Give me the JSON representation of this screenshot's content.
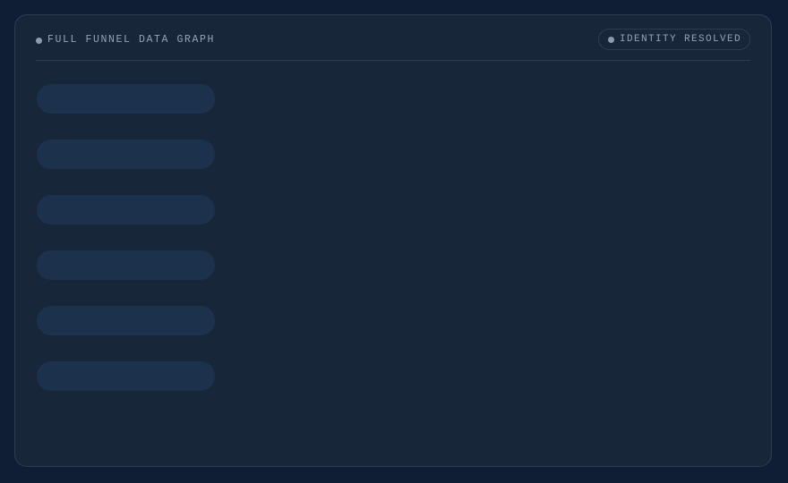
{
  "header": {
    "title": "FULL FUNNEL DATA GRAPH",
    "status_badge": "IDENTITY RESOLVED"
  },
  "colors": {
    "background": "#0f1e34",
    "panel": "#172639",
    "border": "#2b3d55",
    "skeleton": "#1c314b",
    "text": "#94a3b8"
  },
  "rows": [
    {
      "label": ""
    },
    {
      "label": ""
    },
    {
      "label": ""
    },
    {
      "label": ""
    },
    {
      "label": ""
    },
    {
      "label": ""
    }
  ]
}
